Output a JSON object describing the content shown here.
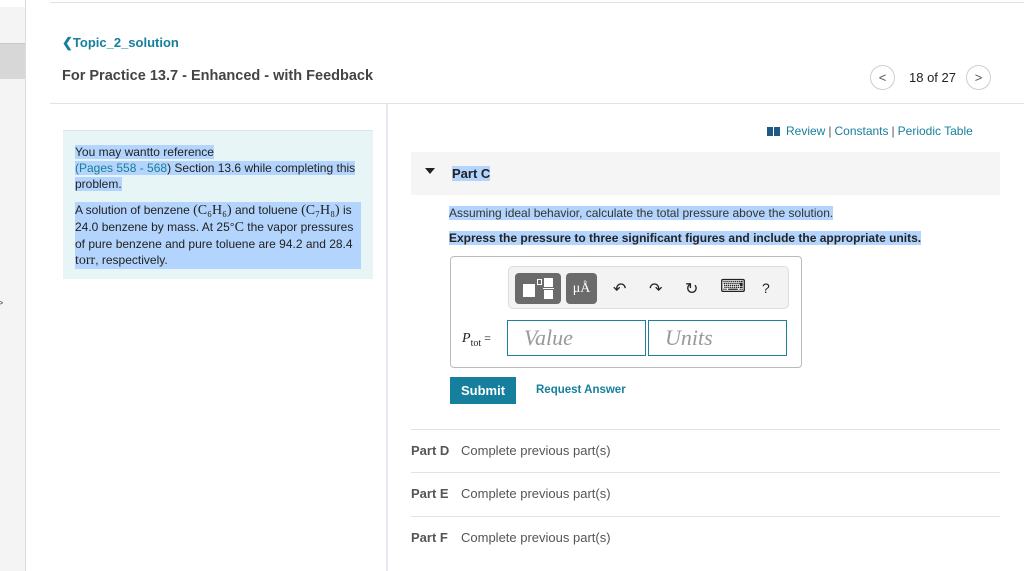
{
  "sidebar": {
    "expand_icon": "chevron-right-icon"
  },
  "header": {
    "breadcrumb": "Topic_2_solution",
    "title": "For Practice 13.7 - Enhanced - with Feedback",
    "pager": {
      "current": 18,
      "total": 27,
      "label": "18 of 27"
    }
  },
  "reference": {
    "intro_1": "You may wantto reference",
    "pages_link": "(Pages 558 - 568",
    "intro_2": ") Section 13.6 while completing this problem.",
    "problem_a": "A solution of benzene",
    "benzene_formula": "(C₆H₆)",
    "problem_b": "and toluene",
    "toluene_formula": "(C₇H₈)",
    "problem_c": "is 24.0 benzene by mass. At 25°",
    "temp_unit": "C",
    "problem_d": "the vapor pressures of pure benzene and pure toluene are 94.2 and 28.4",
    "pressure_unit": "torr",
    "problem_e": ", respectively."
  },
  "resources": {
    "icon": "book-icon",
    "review": "Review",
    "constants": "Constants",
    "periodic_table": "Periodic Table",
    "separator": "|"
  },
  "part_c": {
    "label": "Part C",
    "question": "Assuming ideal behavior, calculate the total pressure above the solution.",
    "instruction": "Express the pressure to three significant figures and include the appropriate units.",
    "toolbar": {
      "units_label": "μÅ",
      "undo": "↶",
      "redo": "↷",
      "reset": "↻",
      "keyboard": "⌨",
      "help": "?"
    },
    "answer_label": "P",
    "answer_sub": "tot",
    "equals": "=",
    "value_placeholder": "Value",
    "units_placeholder": "Units",
    "submit": "Submit",
    "request_answer": "Request Answer"
  },
  "locked_parts": [
    {
      "label": "Part D",
      "status": "Complete previous part(s)"
    },
    {
      "label": "Part E",
      "status": "Complete previous part(s)"
    },
    {
      "label": "Part F",
      "status": "Complete previous part(s)"
    }
  ]
}
